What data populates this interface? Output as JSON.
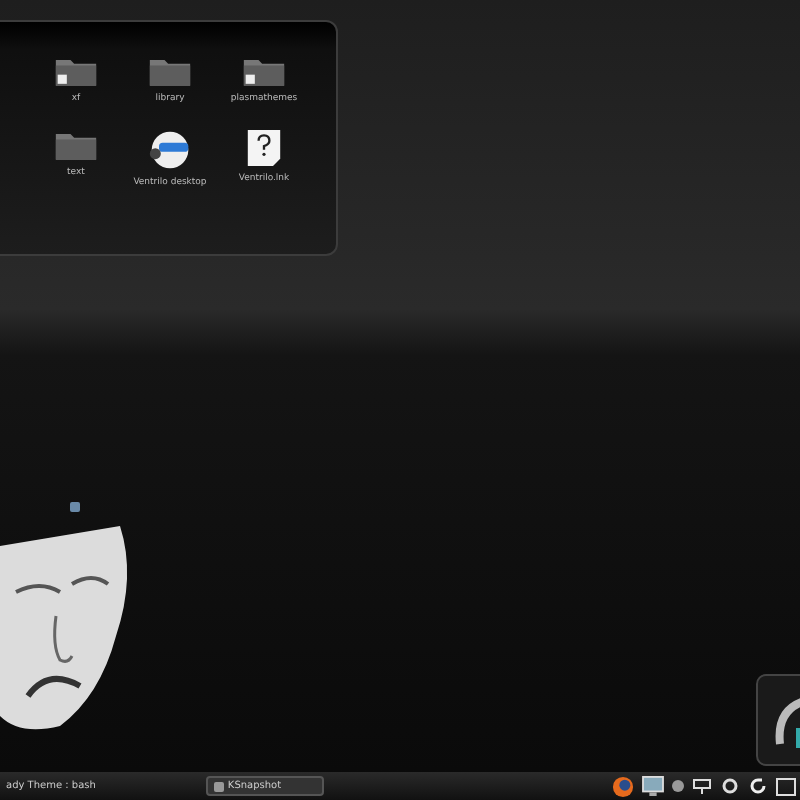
{
  "folder_view": {
    "items": [
      {
        "label": "xf",
        "kind": "folder-link"
      },
      {
        "label": "library",
        "kind": "folder"
      },
      {
        "label": "plasmathemes",
        "kind": "folder-link"
      },
      {
        "label": "text",
        "kind": "folder"
      },
      {
        "label": "Ventrilo desktop",
        "kind": "app"
      },
      {
        "label": "Ventrilo.lnk",
        "kind": "unknown"
      }
    ]
  },
  "taskbar": {
    "tasks": [
      {
        "label": "ady Theme : bash",
        "selected": false
      },
      {
        "label": "KSnapshot",
        "selected": true
      }
    ]
  }
}
